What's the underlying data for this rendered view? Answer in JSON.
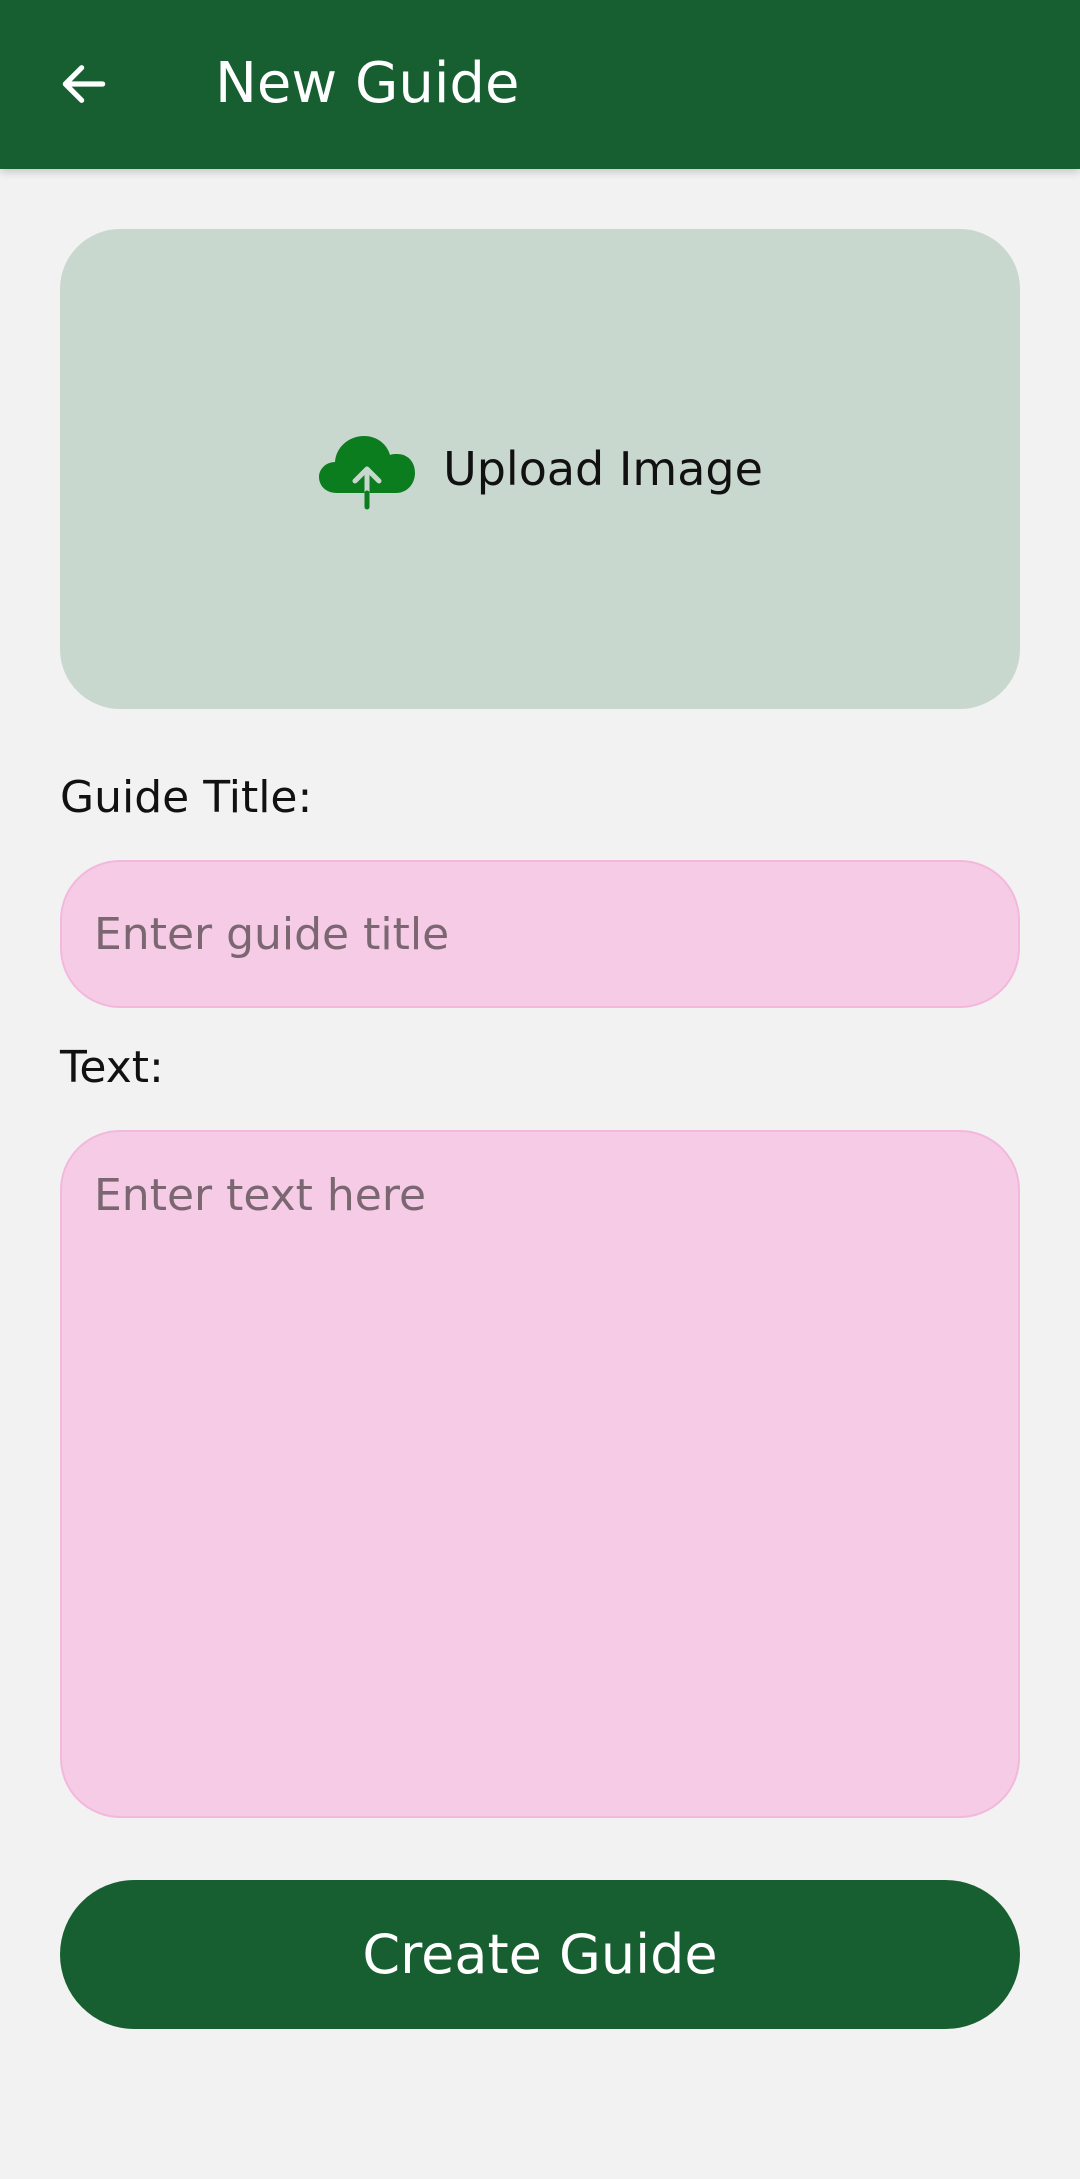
{
  "app_bar": {
    "title": "New Guide",
    "back_icon": "arrow-left-icon",
    "color": "#175f31"
  },
  "upload": {
    "label": "Upload Image",
    "icon": "cloud-upload-icon",
    "icon_color": "#0b7d1e",
    "background": "#c9d8ce"
  },
  "form": {
    "title_label": "Guide Title:",
    "title_placeholder": "Enter guide title",
    "title_value": "",
    "text_label": "Text:",
    "text_placeholder": "Enter text here",
    "text_value": "",
    "field_color": "#f5cbe5"
  },
  "actions": {
    "create_label": "Create Guide"
  }
}
